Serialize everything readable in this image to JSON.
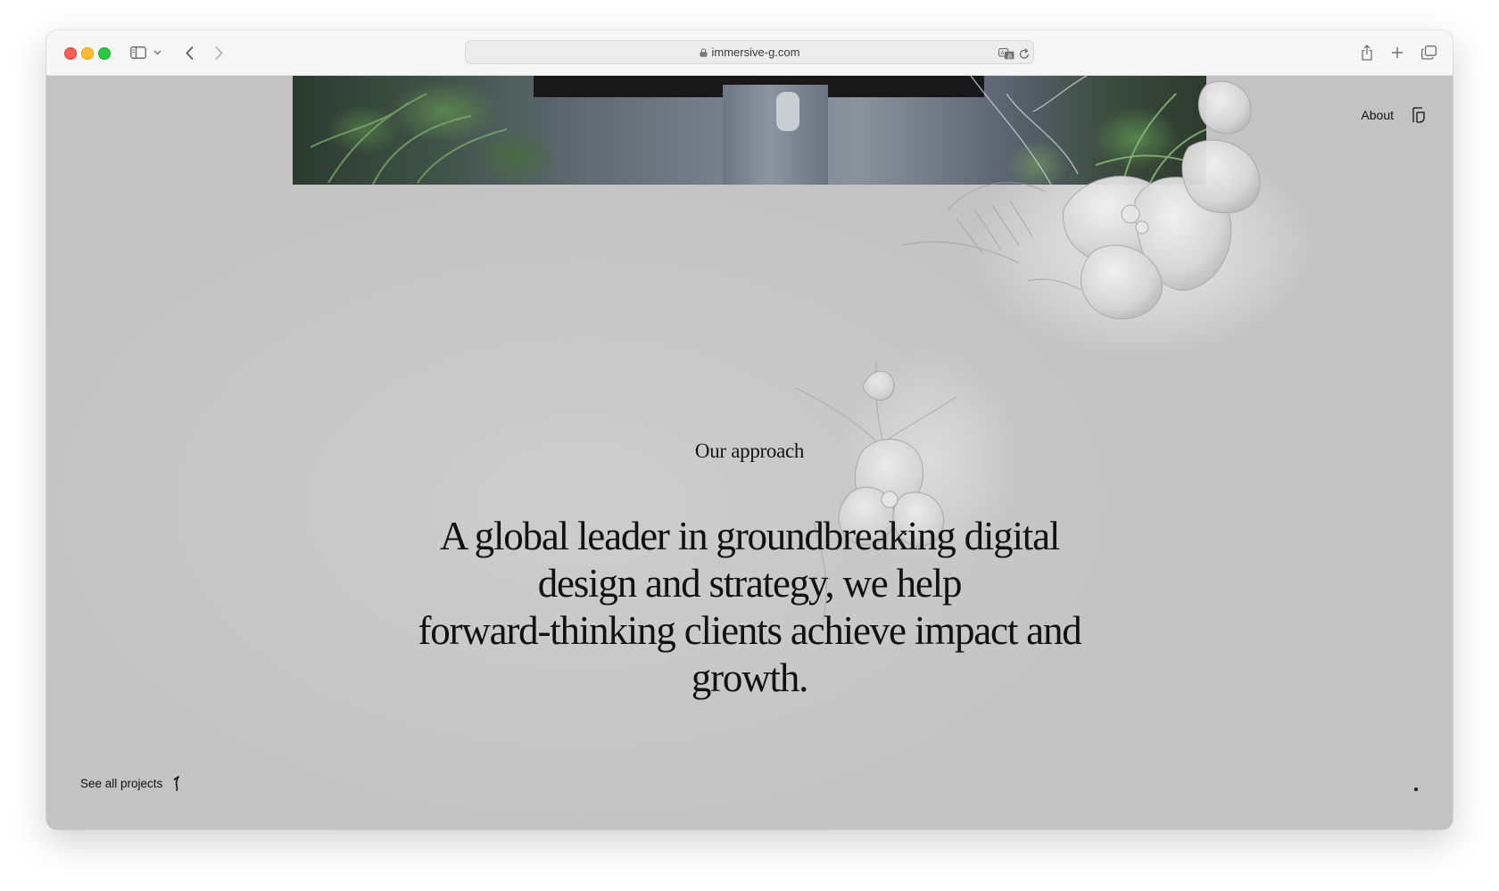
{
  "browser": {
    "url": "immersive-g.com"
  },
  "nav": {
    "about_label": "About"
  },
  "main": {
    "kicker": "Our approach",
    "headline_lines": [
      "A global leader in groundbreaking digital",
      "design and strategy, we help",
      "forward-thinking clients achieve impact and",
      "growth."
    ]
  },
  "footer": {
    "see_all_label": "See all projects"
  },
  "colors": {
    "background": "#c8c8c8",
    "text": "#111111",
    "toolbar": "#f6f6f6"
  },
  "icons": {
    "sidebar": "sidebar-icon",
    "back": "chevron-left-icon",
    "forward": "chevron-right-icon",
    "share": "share-icon",
    "new_tab": "plus-icon",
    "tabs": "tab-overview-icon",
    "translate": "translate-icon",
    "reload": "reload-icon",
    "logo": "brand-logo-icon",
    "arrow": "arrow-icon"
  }
}
